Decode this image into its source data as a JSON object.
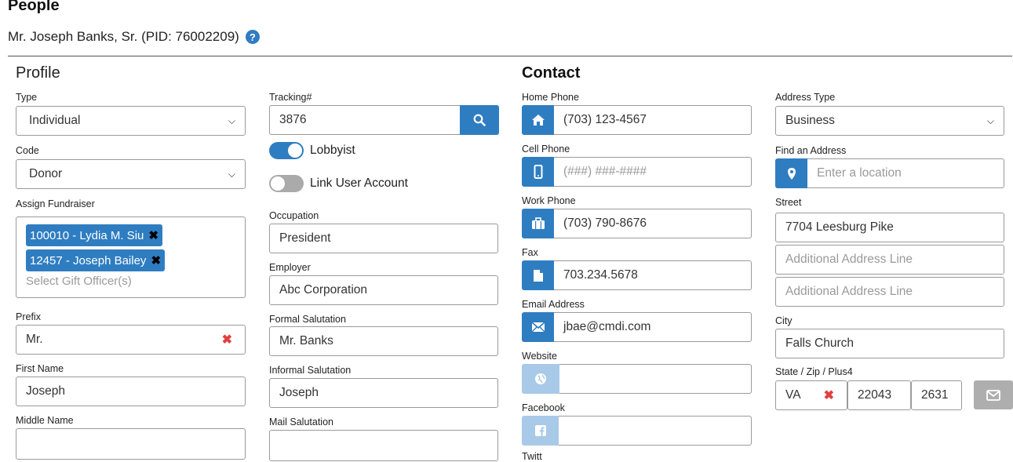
{
  "page": {
    "title": "People",
    "person": "Mr. Joseph Banks, Sr. (PID: 76002209)",
    "help_icon": "?"
  },
  "profile": {
    "heading": "Profile",
    "type": {
      "label": "Type",
      "value": "Individual"
    },
    "code": {
      "label": "Code",
      "value": "Donor"
    },
    "assign_fundraiser": {
      "label": "Assign Fundraiser",
      "tags": [
        "100010 - Lydia M. Siu",
        "12457 - Joseph Bailey"
      ],
      "placeholder": "Select Gift Officer(s)"
    },
    "prefix": {
      "label": "Prefix",
      "value": "Mr."
    },
    "first_name": {
      "label": "First Name",
      "value": "Joseph"
    },
    "middle_name": {
      "label": "Middle Name",
      "value": ""
    },
    "tracking": {
      "label": "Tracking#",
      "value": "3876"
    },
    "lobbyist": {
      "label": "Lobbyist",
      "on": true
    },
    "link_user": {
      "label": "Link User Account",
      "on": false
    },
    "occupation": {
      "label": "Occupation",
      "value": "President"
    },
    "employer": {
      "label": "Employer",
      "value": "Abc Corporation"
    },
    "formal_salutation": {
      "label": "Formal Salutation",
      "value": "Mr. Banks"
    },
    "informal_salutation": {
      "label": "Informal Salutation",
      "value": "Joseph"
    },
    "mail_salutation": {
      "label": "Mail Salutation",
      "value": ""
    }
  },
  "contact": {
    "heading": "Contact",
    "home_phone": {
      "label": "Home Phone",
      "value": "(703) 123-4567",
      "icon": "home-icon"
    },
    "cell_phone": {
      "label": "Cell Phone",
      "placeholder": "(###) ###-####",
      "icon": "mobile-phone-icon"
    },
    "work_phone": {
      "label": "Work Phone",
      "value": "(703) 790-8676",
      "icon": "briefcase-icon"
    },
    "fax": {
      "label": "Fax",
      "value": "703.234.5678",
      "icon": "file-icon"
    },
    "email": {
      "label": "Email Address",
      "value": "jbae@cmdi.com",
      "icon": "envelope-icon"
    },
    "website": {
      "label": "Website",
      "value": "",
      "icon": "globe-icon"
    },
    "facebook": {
      "label": "Facebook",
      "value": "",
      "icon": "facebook-icon"
    },
    "twitter_partial": "Twitt",
    "address_type": {
      "label": "Address Type",
      "value": "Business"
    },
    "find_address": {
      "label": "Find an Address",
      "placeholder": "Enter a location",
      "icon": "map-marker-icon"
    },
    "street": {
      "label": "Street",
      "value": "7704 Leesburg Pike"
    },
    "address_line2": {
      "placeholder": "Additional Address Line"
    },
    "address_line3": {
      "placeholder": "Additional Address Line"
    },
    "city": {
      "label": "City",
      "value": "Falls Church"
    },
    "state_zip": {
      "label": "State / Zip / Plus4",
      "state": "VA",
      "zip": "22043",
      "plus4": "2631"
    }
  }
}
